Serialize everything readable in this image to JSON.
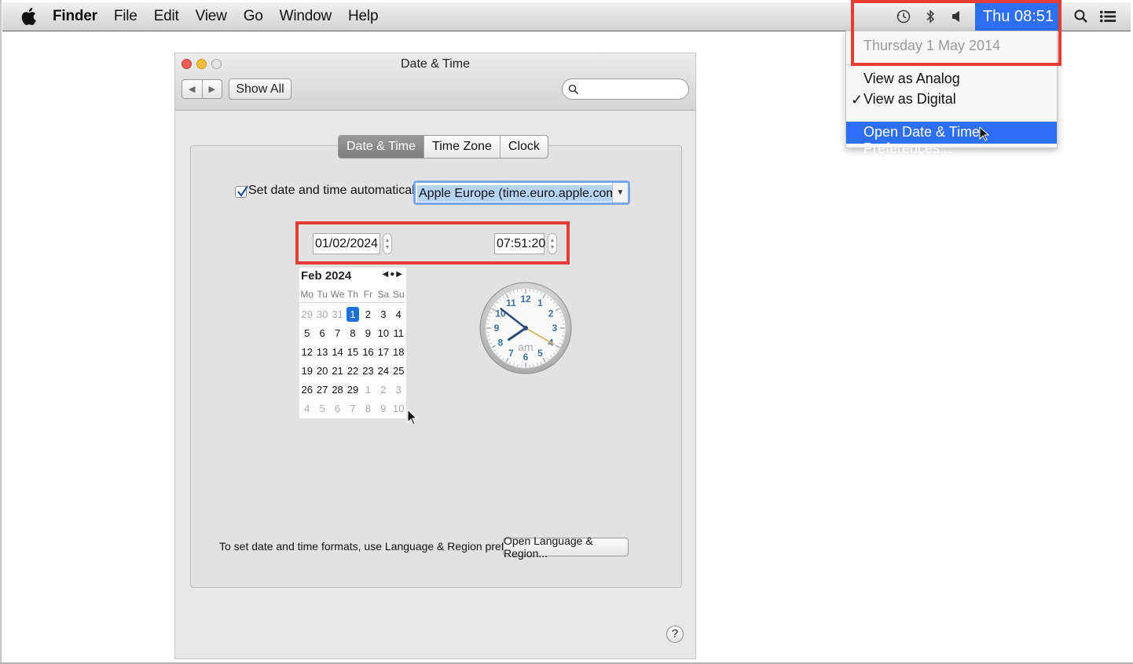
{
  "menubar": {
    "app_name": "Finder",
    "items": [
      "File",
      "Edit",
      "View",
      "Go",
      "Window",
      "Help"
    ],
    "clock": "Thu 08:51",
    "status_icons": [
      "time-machine-icon",
      "bluetooth-icon",
      "volume-icon",
      "spotlight-search-icon",
      "notification-center-icon"
    ]
  },
  "clock_menu": {
    "date": "Thursday 1 May 2014",
    "view_analog": "View as Analog",
    "view_digital": "View as Digital",
    "checkmark": "✓",
    "open_prefs": "Open Date & Time Preferences..."
  },
  "window": {
    "title": "Date & Time",
    "show_all": "Show All",
    "search_placeholder": "",
    "tabs": [
      "Date & Time",
      "Time Zone",
      "Clock"
    ],
    "active_tab": "Date & Time",
    "set_auto_label": "Set date and time automatically:",
    "set_auto_checked": true,
    "server": "Apple Europe (time.euro.apple.com.)",
    "date_value": "01/02/2024",
    "time_value": "07:51:20",
    "calendar": {
      "month_label": "Feb 2024",
      "weekdays": [
        "Mo",
        "Tu",
        "We",
        "Th",
        "Fr",
        "Sa",
        "Su"
      ],
      "days": [
        "29",
        "30",
        "31",
        "1",
        "2",
        "3",
        "4",
        "5",
        "6",
        "7",
        "8",
        "9",
        "10",
        "11",
        "12",
        "13",
        "14",
        "15",
        "16",
        "17",
        "18",
        "19",
        "20",
        "21",
        "22",
        "23",
        "24",
        "25",
        "26",
        "27",
        "28",
        "29",
        "1",
        "2",
        "3",
        "4",
        "5",
        "6",
        "7",
        "8",
        "9",
        "10"
      ],
      "selected_day": "1"
    },
    "analog_clock": {
      "numbers": [
        "12",
        "1",
        "2",
        "3",
        "4",
        "5",
        "6",
        "7",
        "8",
        "9",
        "10",
        "11"
      ],
      "period": "am",
      "time": "07:51:20"
    },
    "formats_text": "To set date and time formats, use Language & Region preferences.",
    "open_language_button": "Open Language & Region...",
    "help": "?"
  },
  "colors": {
    "highlight": "#2d6ff6",
    "annotation_red": "#e53c35",
    "selected_day": "#1f6fd9"
  }
}
